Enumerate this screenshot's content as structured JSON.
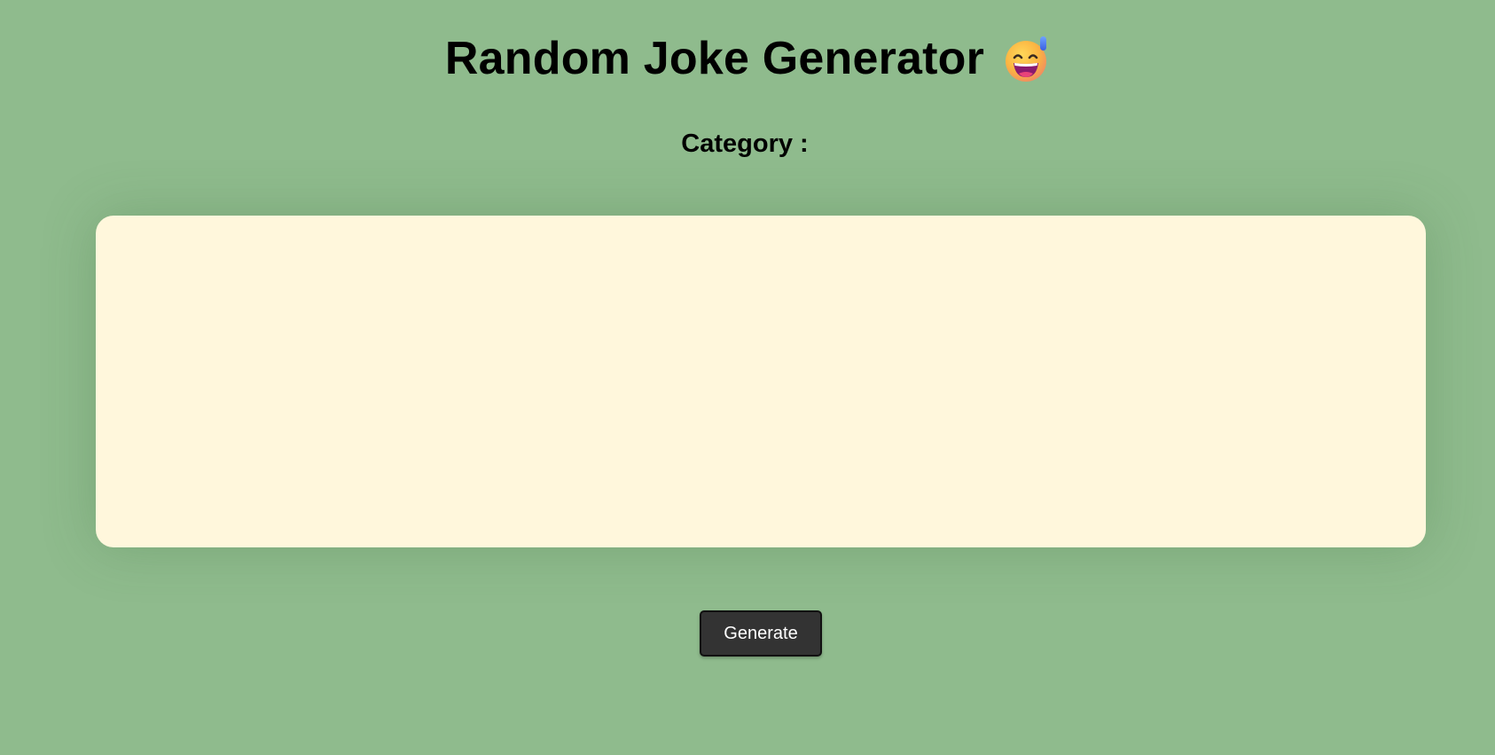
{
  "header": {
    "title": "Random Joke Generator",
    "emoji_icon": "grinning-face-with-sweat-icon"
  },
  "category": {
    "label": "Category :",
    "value": ""
  },
  "joke": {
    "text": ""
  },
  "actions": {
    "generate_label": "Generate"
  },
  "colors": {
    "background": "#8fbb8d",
    "card": "#fff7dc",
    "button": "#333333",
    "button_text": "#ffffff"
  }
}
